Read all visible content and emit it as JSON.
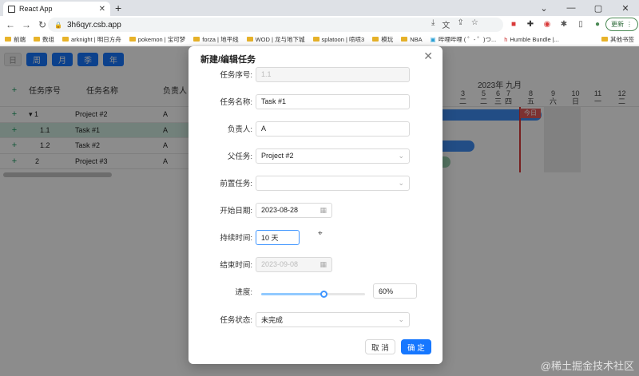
{
  "browser": {
    "tab_title": "React App",
    "url": "3h6qyr.csb.app",
    "update_label": "更新",
    "bookmarks": [
      "前端",
      "数组",
      "arknight | 明日方舟",
      "pokemon | 宝可梦",
      "forza | 地平线",
      "WOD | 龙与地下城",
      "splatoon | 喷喷3",
      "模玩",
      "NBA",
      "哔哩哔哩 ( ゜- ゜)つ...",
      "Humble Bundle |...",
      "其他书签"
    ]
  },
  "app": {
    "view_buttons": [
      "日",
      "周",
      "月",
      "季",
      "年"
    ],
    "grid": {
      "headers": [
        "任务序号",
        "任务名称",
        "负责人"
      ],
      "rows": [
        {
          "seq": "▾ 1",
          "name": "Project #2",
          "owner": "A"
        },
        {
          "seq": "1.1",
          "name": "Task #1",
          "owner": "A"
        },
        {
          "seq": "1.2",
          "name": "Task #2",
          "owner": "A"
        },
        {
          "seq": "2",
          "name": "Project #3",
          "owner": "A"
        }
      ]
    },
    "gantt": {
      "month_label": "2023年 九月",
      "days": [
        {
          "num": "3",
          "wd": "二"
        },
        {
          "num": "5",
          "wd": "二"
        },
        {
          "num": "6",
          "wd": "三"
        },
        {
          "num": "7",
          "wd": "四"
        },
        {
          "num": "8",
          "wd": "五"
        },
        {
          "num": "9",
          "wd": "六"
        },
        {
          "num": "10",
          "wd": "日"
        },
        {
          "num": "11",
          "wd": "一"
        },
        {
          "num": "12",
          "wd": "二"
        }
      ],
      "today_label": "今日"
    }
  },
  "modal": {
    "title": "新建/编辑任务",
    "fields": {
      "seq": {
        "label": "任务序号:",
        "value": "1.1"
      },
      "name": {
        "label": "任务名称:",
        "value": "Task #1"
      },
      "owner": {
        "label": "负责人:",
        "value": "A"
      },
      "parent": {
        "label": "父任务:",
        "value": "Project #2"
      },
      "predecessor": {
        "label": "前置任务:",
        "value": ""
      },
      "start": {
        "label": "开始日期:",
        "value": "2023-08-28"
      },
      "duration": {
        "label": "持续时间:",
        "value": "10 天"
      },
      "end": {
        "label": "结束时间:",
        "value": "2023-09-08"
      },
      "progress": {
        "label": "进度:",
        "value": "60%",
        "fraction": 0.6
      },
      "status": {
        "label": "任务状态:",
        "value": "未完成"
      }
    },
    "cancel_label": "取 消",
    "ok_label": "确 定"
  },
  "watermark": "@稀土掘金技术社区",
  "colors": {
    "primary": "#1677ff",
    "selected_row": "#cfece0",
    "today": "#e35a5a",
    "bar": "#3f8cf3"
  }
}
